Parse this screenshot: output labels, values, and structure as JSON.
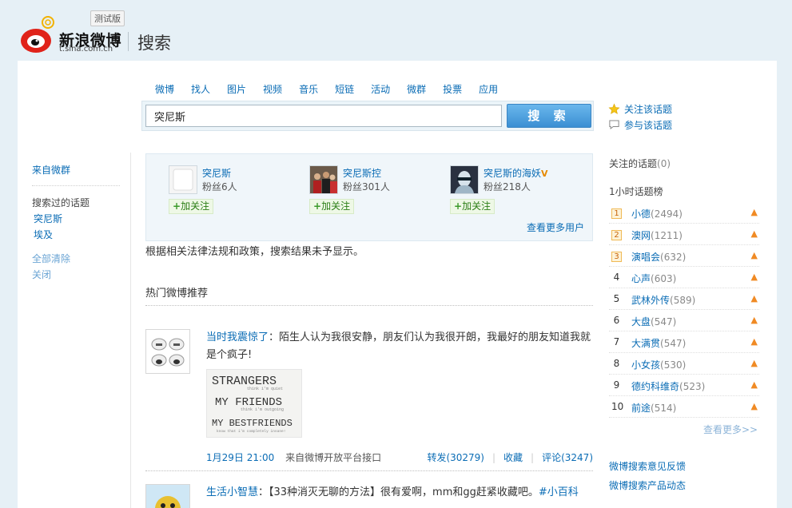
{
  "header": {
    "beta_label": "测试版",
    "brand": "新浪微博",
    "brand_url": "t.sina.com.cn",
    "title": "搜索"
  },
  "search": {
    "nav": [
      "微博",
      "找人",
      "图片",
      "视频",
      "音乐",
      "短链",
      "活动",
      "微群",
      "投票",
      "应用"
    ],
    "active_nav": "微博",
    "query": "突尼斯",
    "button_label": "搜 索",
    "follow_topic": "关注该话题",
    "join_topic": "参与该话题"
  },
  "left": {
    "from_group": "来自微群",
    "searched_label": "搜索过的话题",
    "searched": [
      "突尼斯",
      "埃及"
    ],
    "clear_all": "全部清除",
    "close": "关闭"
  },
  "users": {
    "items": [
      {
        "name": "突尼斯",
        "fans": "粉丝6人",
        "follow": "加关注",
        "verified": false,
        "avatar_icon": "blank-avatar"
      },
      {
        "name": "突尼斯控",
        "fans": "粉丝301人",
        "follow": "加关注",
        "verified": false,
        "avatar_icon": "crowd-photo-avatar"
      },
      {
        "name": "突尼斯的海妖",
        "fans": "粉丝218人",
        "follow": "加关注",
        "verified": true,
        "avatar_icon": "face-photo-avatar"
      }
    ],
    "more": "查看更多用户"
  },
  "notice": "根据相关法律法规和政策，搜索结果未予显示。",
  "hot": {
    "title": "热门微博推荐"
  },
  "feeds": [
    {
      "author": "当时我震惊了",
      "text": "：陌生人认为我很安静，朋友们认为我很开朗，我最好的朋友知道我就是个疯子!",
      "image_lines": [
        "STRANGERS",
        "think i'm quiet",
        "MY FRIENDS",
        "think i'm outgoing",
        "MY BESTFRIENDS",
        "know that i'm completely insane!"
      ],
      "time": "1月29日 21:00",
      "source": "来自微博开放平台接口",
      "repost": "转发(30279)",
      "favorite": "收藏",
      "comment": "评论(3247)"
    },
    {
      "author": "生活小智慧",
      "text": "：【33种消灭无聊的方法】很有爱啊，mm和gg赶紧收藏吧。",
      "tag": "#小百科"
    }
  ],
  "right": {
    "follow_topics": "关注的话题",
    "follow_count": "(0)",
    "rank_title": "1小时话题榜",
    "rank": [
      {
        "num": "1",
        "kw": "小德",
        "cnt": "(2494)"
      },
      {
        "num": "2",
        "kw": "澳网",
        "cnt": "(1211)"
      },
      {
        "num": "3",
        "kw": "演唱会",
        "cnt": "(632)"
      },
      {
        "num": "4",
        "kw": "心声",
        "cnt": "(603)"
      },
      {
        "num": "5",
        "kw": "武林外传",
        "cnt": "(589)"
      },
      {
        "num": "6",
        "kw": "大盘",
        "cnt": "(547)"
      },
      {
        "num": "7",
        "kw": "大满贯",
        "cnt": "(547)"
      },
      {
        "num": "8",
        "kw": "小女孩",
        "cnt": "(530)"
      },
      {
        "num": "9",
        "kw": "德约科维奇",
        "cnt": "(523)"
      },
      {
        "num": "10",
        "kw": "前途",
        "cnt": "(514)"
      }
    ],
    "more": "查看更多>>",
    "feedback": "微博搜索意见反馈",
    "product": "微博搜索产品动态"
  }
}
